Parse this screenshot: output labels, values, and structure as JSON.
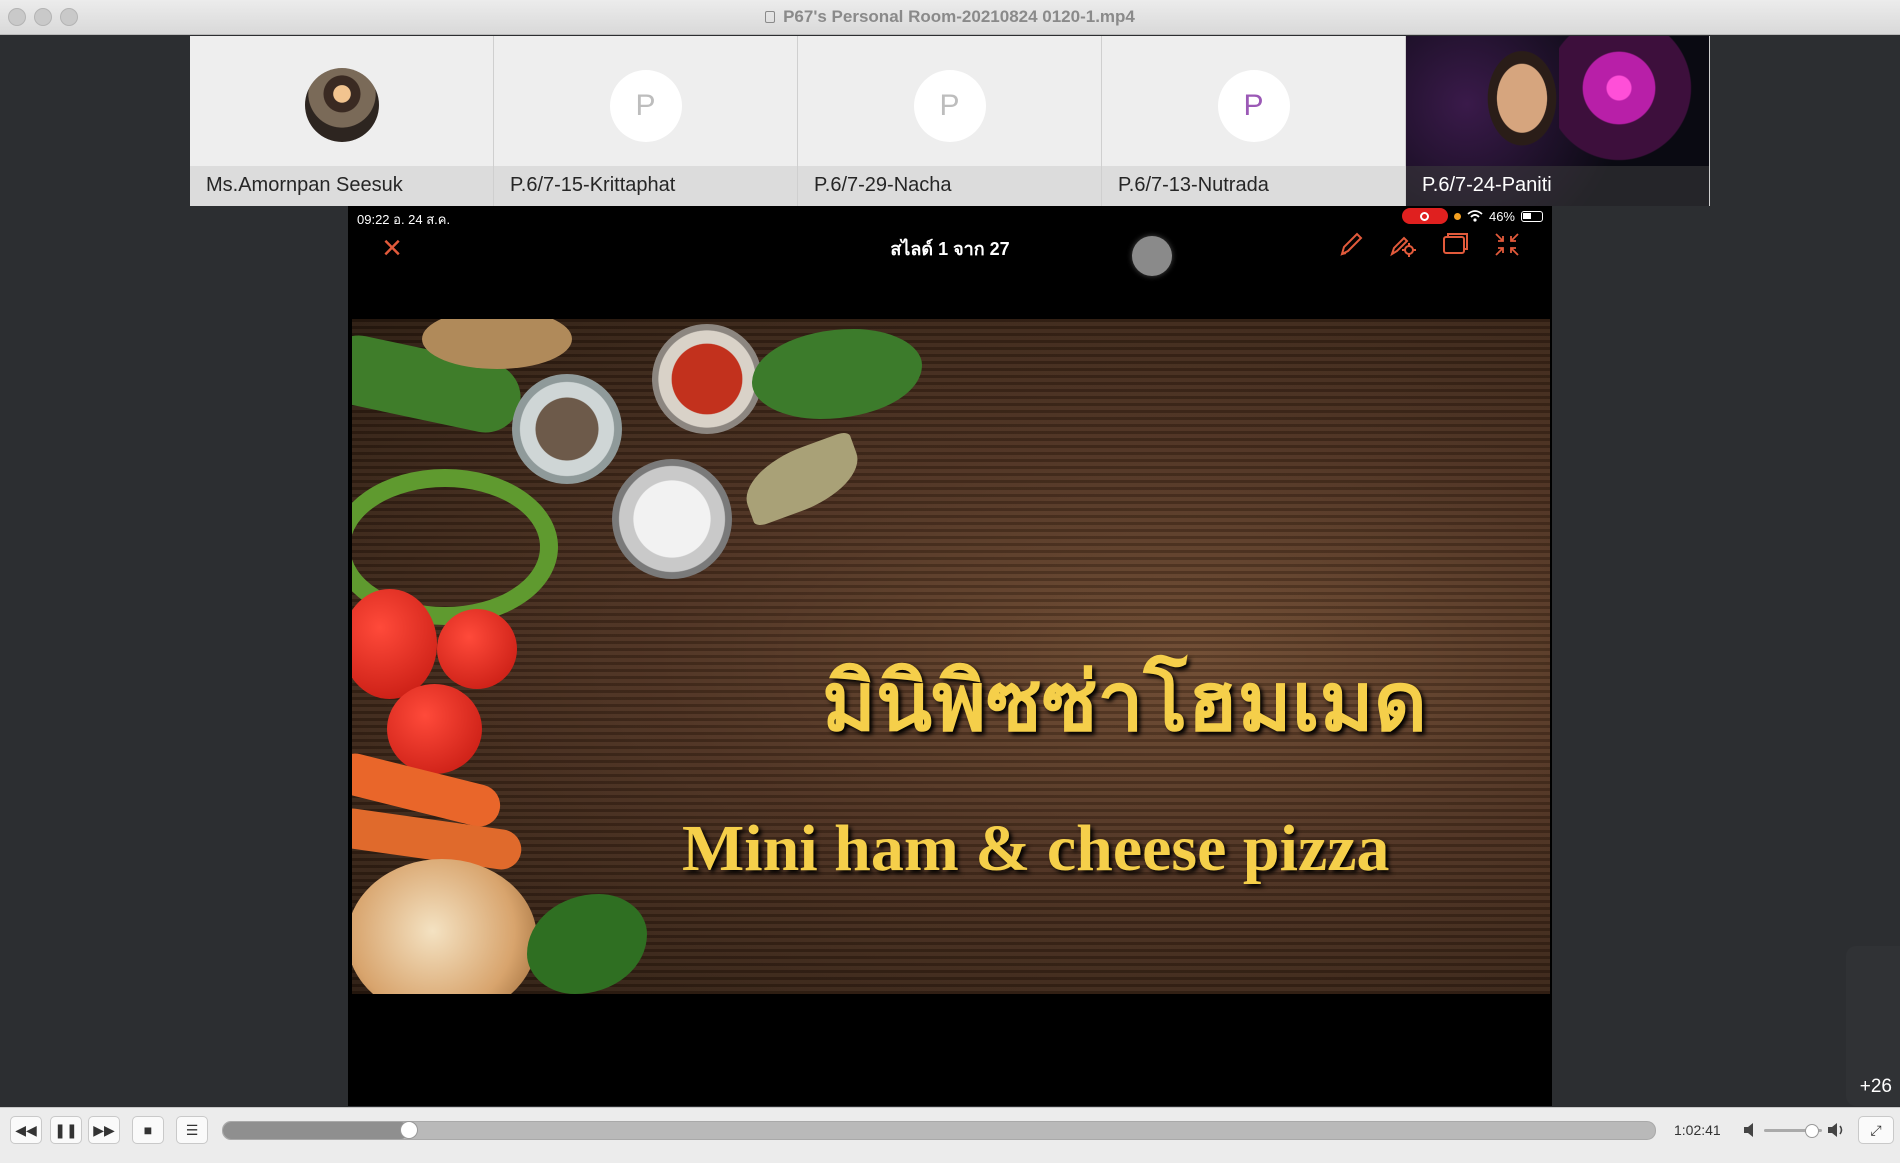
{
  "window": {
    "title": "P67's Personal Room-20210824 0120-1.mp4"
  },
  "participants": [
    {
      "name": "Ms.Amornpan Seesuk",
      "avatar": "photo"
    },
    {
      "name": "P.6/7-15-Krittaphat",
      "avatar": "initial",
      "initial": "P"
    },
    {
      "name": "P.6/7-29-Nacha",
      "avatar": "initial",
      "initial": "P"
    },
    {
      "name": "P.6/7-13-Nutrada",
      "avatar": "initial",
      "initial": "P",
      "initial_color": "#9b59b6"
    },
    {
      "name": "P.6/7-24-Paniti",
      "avatar": "video"
    }
  ],
  "share": {
    "status_time": "09:22  อ. 24 ส.ค.",
    "battery": "46%",
    "slide_counter": "สไลด์ 1 จาก 27",
    "tools": [
      "pencil-icon",
      "annotate-settings-icon",
      "window-icon",
      "collapse-icon"
    ],
    "slide": {
      "thai_title": "มินิพิซซ่าโฮมเมด",
      "english_title": "Mini ham & cheese pizza"
    }
  },
  "more_participants": "+26",
  "player": {
    "elapsed": "1:02:41",
    "progress_fraction": 0.13,
    "volume_fraction": 0.83,
    "buttons": [
      "rewind-icon",
      "pause-icon",
      "fast-forward-icon",
      "stop-icon",
      "chapters-icon"
    ]
  },
  "colors": {
    "accent": "#e25a3b",
    "record": "#e0201f",
    "slide_text": "#f5cf4a"
  }
}
